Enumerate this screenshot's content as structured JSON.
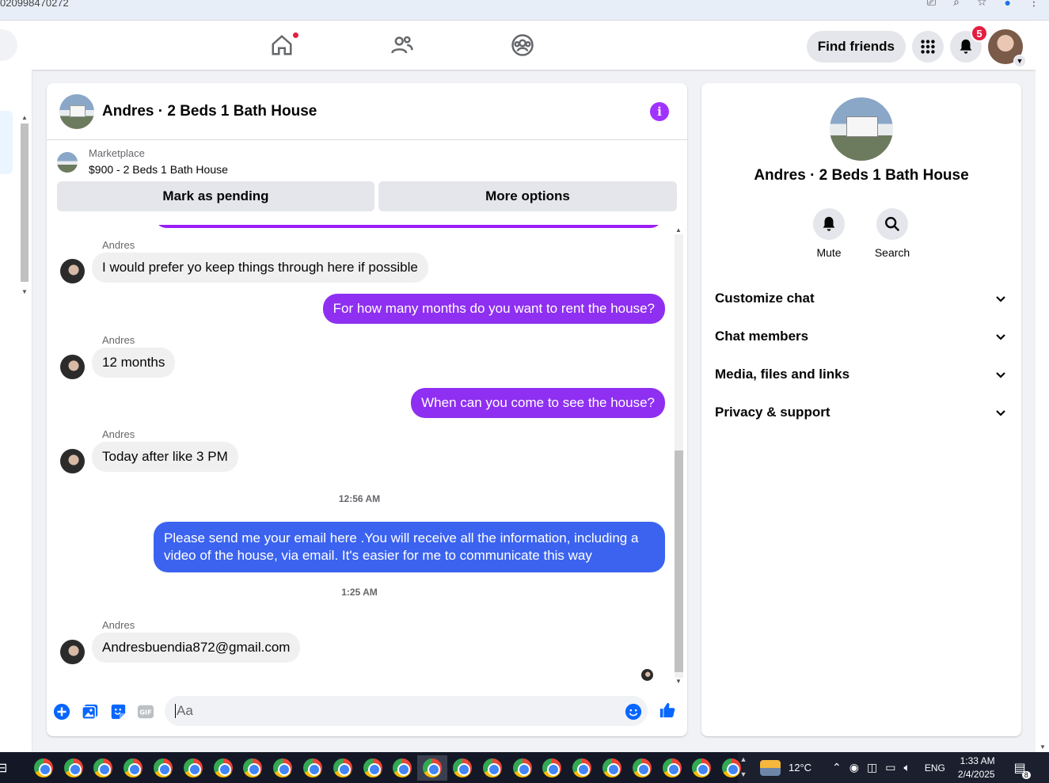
{
  "browser": {
    "url_fragment": "020998470272"
  },
  "nav": {
    "find_friends": "Find friends",
    "notifications_count": "5"
  },
  "chat": {
    "title": "Andres · 2 Beds 1 Bath House",
    "marketplace_label": "Marketplace",
    "marketplace_item": "$900 - 2 Beds 1 Bath House",
    "mark_pending": "Mark as pending",
    "more_options": "More options",
    "messages": [
      {
        "sender": "Andres",
        "text": "I would prefer yo keep things through here if possible",
        "direction": "in"
      },
      {
        "text": "For how many months do you want to rent the house?",
        "direction": "out"
      },
      {
        "sender": "Andres",
        "text": "12 months",
        "direction": "in"
      },
      {
        "text": "When can you come to see the house?",
        "direction": "out"
      },
      {
        "sender": "Andres",
        "text": "Today after like 3 PM",
        "direction": "in"
      },
      {
        "timestamp": "12:56 AM"
      },
      {
        "text": "Please send me your email here .You will receive all the information, including a video of the house, via email. It's easier for me to communicate this way",
        "direction": "out"
      },
      {
        "timestamp": "1:25 AM"
      },
      {
        "sender": "Andres",
        "text": "Andresbuendia872@gmail.com",
        "direction": "in"
      }
    ],
    "composer_placeholder": "Aa"
  },
  "info_panel": {
    "name": "Andres · 2 Beds 1 Bath House",
    "actions": [
      {
        "label": "Mute",
        "icon": "bell-icon"
      },
      {
        "label": "Search",
        "icon": "search-icon"
      }
    ],
    "sections": [
      {
        "label": "Customize chat"
      },
      {
        "label": "Chat members"
      },
      {
        "label": "Media, files and links"
      },
      {
        "label": "Privacy & support"
      }
    ]
  },
  "taskbar": {
    "temperature": "12°C",
    "language": "ENG",
    "time": "1:33 AM",
    "date": "2/4/2025",
    "notification_count": "8"
  },
  "colors": {
    "accent_purple": "#8e2ff1",
    "accent_blue": "#3b63f0",
    "fb_blue": "#0866ff",
    "badge_red": "#e41e3f"
  }
}
